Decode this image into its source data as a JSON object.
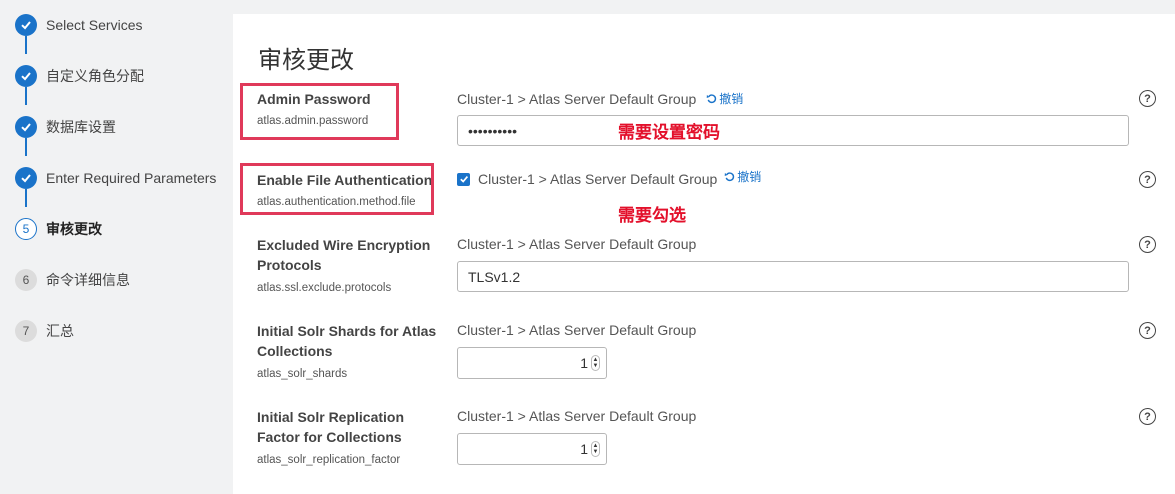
{
  "steps": [
    {
      "label": "Select Services",
      "state": "done"
    },
    {
      "label": "自定义角色分配",
      "state": "done"
    },
    {
      "label": "数据库设置",
      "state": "done"
    },
    {
      "label": "Enter Required Parameters",
      "state": "done"
    },
    {
      "label": "审核更改",
      "num": "5",
      "state": "active"
    },
    {
      "label": "命令详细信息",
      "num": "6",
      "state": "todo"
    },
    {
      "label": "汇总",
      "num": "7",
      "state": "todo"
    }
  ],
  "page": {
    "title": "审核更改"
  },
  "params": [
    {
      "name": "Admin Password",
      "key": "atlas.admin.password",
      "scope": "Cluster-1 > Atlas Server Default Group",
      "undo": "撤销",
      "value": "••••••••••",
      "help": "?"
    },
    {
      "name": "Enable File Authentication",
      "key": "atlas.authentication.method.file",
      "scope": "Cluster-1 > Atlas Server Default Group",
      "undo": "撤销",
      "checked": true,
      "help": "?"
    },
    {
      "name": "Excluded Wire Encryption Protocols",
      "key": "atlas.ssl.exclude.protocols",
      "scope": "Cluster-1 > Atlas Server Default Group",
      "value": "TLSv1.2",
      "help": "?"
    },
    {
      "name": "Initial Solr Shards for Atlas Collections",
      "key": "atlas_solr_shards",
      "scope": "Cluster-1 > Atlas Server Default Group",
      "value": "1",
      "help": "?"
    },
    {
      "name": "Initial Solr Replication Factor for Collections",
      "key": "atlas_solr_replication_factor",
      "scope": "Cluster-1 > Atlas Server Default Group",
      "value": "1",
      "help": "?"
    }
  ],
  "annotations": {
    "password_note": "需要设置密码",
    "checkbox_note": "需要勾选"
  },
  "colors": {
    "accent": "#1a73c9",
    "annotation_red": "#e3102b",
    "highlight_box": "#e0395a"
  }
}
